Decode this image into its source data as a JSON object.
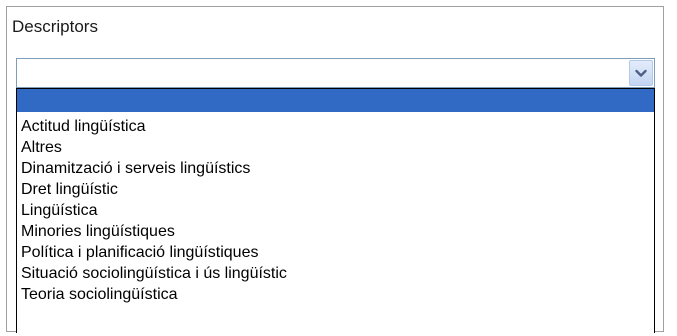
{
  "field": {
    "label": "Descriptors",
    "selected_value": ""
  },
  "dropdown": {
    "icon": "chevron-down-icon",
    "highlight_color": "#316ac5",
    "options": [
      "",
      "Actitud lingüística",
      "Altres",
      "Dinamització i serveis lingüístics",
      "Dret lingüístic",
      "Lingüística",
      "Minories lingüístiques",
      "Política i planificació lingüístiques",
      "Situació sociolingüística i ús lingüístic",
      "Teoria sociolingüística"
    ]
  }
}
